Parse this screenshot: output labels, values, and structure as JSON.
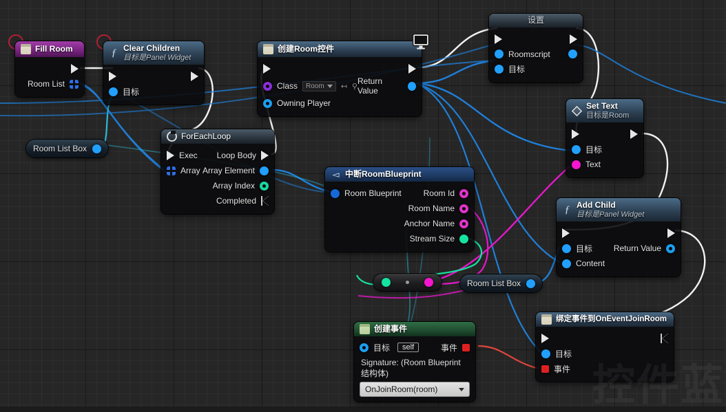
{
  "app": {
    "title": "Unreal Engine Blueprint Graph",
    "watermark": "控件蓝"
  },
  "nodes": {
    "fill_room": {
      "title": "Fill Room",
      "icon": "widget-icon",
      "outputs": [
        {
          "label": "Room List",
          "pin": "array-pin"
        }
      ]
    },
    "clear_children": {
      "title": "Clear Children",
      "subtitle": "目标是Panel Widget",
      "icon": "function-icon",
      "inputs": [
        {
          "label": "目标",
          "pin": "object-pin"
        }
      ]
    },
    "for_each_loop": {
      "title": "ForEachLoop",
      "icon": "loop-icon",
      "inputs": [
        {
          "label": "Exec",
          "pin": "exec-pin"
        },
        {
          "label": "Array",
          "pin": "array-pin"
        }
      ],
      "outputs": [
        {
          "label": "Loop Body",
          "pin": "exec-pin"
        },
        {
          "label": "Array Element",
          "pin": "object-pin"
        },
        {
          "label": "Array Index",
          "pin": "int-pin"
        },
        {
          "label": "Completed",
          "pin": "exec-pin-hollow"
        }
      ]
    },
    "create_room_widget": {
      "title": "创建Room控件",
      "icon": "widget-icon",
      "inputs": [
        {
          "label": "Class",
          "pin": "class-pin",
          "value": "Room"
        },
        {
          "label": "Owning Player",
          "pin": "object-ring-pin"
        }
      ],
      "outputs": [
        {
          "label": "Return Value",
          "pin": "object-pin"
        }
      ]
    },
    "set_node": {
      "title": "设置",
      "inputs": [
        {
          "label": "Roomscript",
          "pin": "object-pin"
        },
        {
          "label": "目标",
          "pin": "object-pin"
        }
      ],
      "outputs": [
        {
          "label": "",
          "pin": "object-pin"
        }
      ]
    },
    "set_text": {
      "title": "Set Text",
      "subtitle": "目标是Room",
      "icon": "diamond-icon",
      "inputs": [
        {
          "label": "目标",
          "pin": "object-pin"
        },
        {
          "label": "Text",
          "pin": "text-pin"
        }
      ]
    },
    "break_room_blueprint": {
      "title": "中断RoomBlueprint",
      "icon": "break-icon",
      "inputs": [
        {
          "label": "Room Blueprint",
          "pin": "struct-pin"
        }
      ],
      "outputs": [
        {
          "label": "Room Id",
          "pin": "name-pin"
        },
        {
          "label": "Room Name",
          "pin": "name-pin"
        },
        {
          "label": "Anchor Name",
          "pin": "name-pin"
        },
        {
          "label": "Stream Size",
          "pin": "vector-pin"
        }
      ]
    },
    "add_child": {
      "title": "Add Child",
      "subtitle": "目标是Panel Widget",
      "icon": "function-icon",
      "inputs": [
        {
          "label": "目标",
          "pin": "object-pin"
        },
        {
          "label": "Content",
          "pin": "object-pin"
        }
      ],
      "outputs": [
        {
          "label": "Return Value",
          "pin": "object-ring-pin"
        }
      ]
    },
    "create_event": {
      "title": "创建事件",
      "icon": "widget-icon-green",
      "target_label": "目标",
      "target_value": "self",
      "event_label": "事件",
      "signature": "Signature: (Room Blueprint 结构体)",
      "selected_signature": "OnJoinRoom(room)"
    },
    "bind_event": {
      "title": "绑定事件到OnEventJoinRoom",
      "icon": "widget-icon",
      "inputs": [
        {
          "label": "目标",
          "pin": "object-pin"
        },
        {
          "label": "事件",
          "pin": "delegate-pin"
        }
      ]
    },
    "room_list_box_left": {
      "label": "Room List Box",
      "pin": "object-pin"
    },
    "room_list_box_right": {
      "label": "Room List Box",
      "pin": "object-pin"
    },
    "converter": {
      "label": ""
    }
  },
  "colors": {
    "exec_wire": "#f2f2f2",
    "object_wire": "#1f7fd8",
    "text_wire": "#e418c8",
    "vector_wire": "#16e2a0",
    "delegate_wire": "#e0453a",
    "cyan_wire": "#2bb9d8",
    "event_header": "#8e2f9b",
    "function_header": "#2c3f52",
    "selection_ring": "#c02035",
    "background": "#262626"
  }
}
